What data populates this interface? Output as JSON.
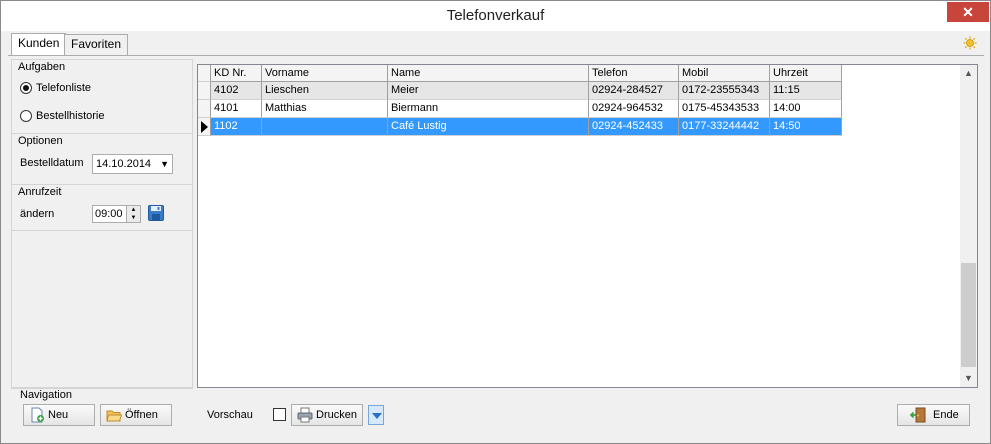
{
  "window": {
    "title": "Telefonverkauf",
    "close_label": "✕"
  },
  "tabs": [
    {
      "label": "Kunden"
    },
    {
      "label": "Favoriten"
    }
  ],
  "aufgaben": {
    "title": "Aufgaben",
    "options": [
      {
        "label": "Telefonliste",
        "checked": true
      },
      {
        "label": "Bestellhistorie",
        "checked": false
      }
    ]
  },
  "optionen": {
    "title": "Optionen",
    "bestelldatum_label": "Bestelldatum",
    "bestelldatum_value": "14.10.2014"
  },
  "anrufzeit": {
    "title": "Anrufzeit",
    "aendern_label": "ändern",
    "time_value": "09:00"
  },
  "grid": {
    "columns": [
      "KD Nr.",
      "Vorname",
      "Name",
      "Telefon",
      "Mobil",
      "Uhrzeit"
    ],
    "rows": [
      [
        "4102",
        "Lieschen",
        "Meier",
        "02924-284527",
        "0172-23555343",
        "11:15"
      ],
      [
        "4101",
        "Matthias",
        "Biermann",
        "02924-964532",
        "0175-45343533",
        "14:00"
      ],
      [
        "1102",
        "",
        "Café Lustig",
        "02924-452433",
        "0177-33244442",
        "14:50"
      ]
    ],
    "selected_row": 2
  },
  "navigation": {
    "title": "Navigation",
    "neu_label": "Neu",
    "oeffnen_label": "Öffnen",
    "vorschau_label": "Vorschau",
    "drucken_label": "Drucken",
    "ende_label": "Ende"
  },
  "icons": {
    "sun": "sun-icon",
    "save": "save-icon",
    "new": "new-document-icon",
    "open": "open-folder-icon",
    "print": "printer-icon",
    "exit": "exit-door-icon"
  }
}
